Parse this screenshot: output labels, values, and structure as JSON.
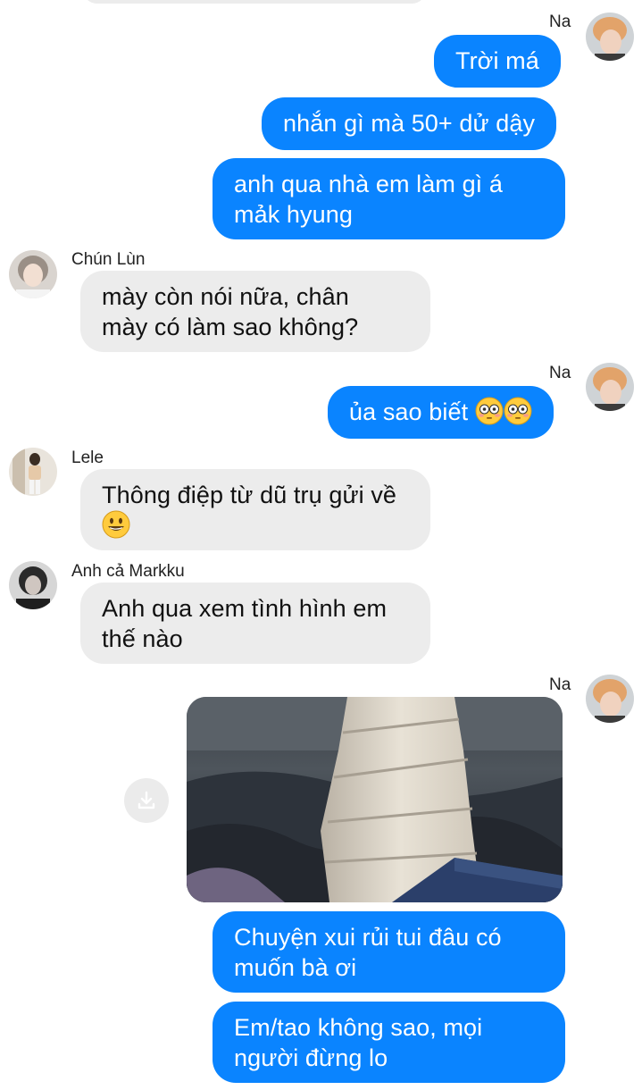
{
  "messages": [
    {
      "sender": "Na",
      "text": "Trời má"
    },
    {
      "text": "nhắn gì mà 50+ dử dậy"
    },
    {
      "text": "anh qua nhà em làm gì á\nmảk hyung"
    },
    {
      "sender": "Chún Lùn",
      "text": "mày còn nói nữa, chân\nmày có làm sao không?"
    },
    {
      "sender": "Na",
      "text": "ủa sao biết "
    },
    {
      "sender": "Lele",
      "text": "Thông điệp từ dũ trụ gửi về\n"
    },
    {
      "sender": "Anh cả Markku",
      "text": "Anh qua xem tình hình em\nthế nào"
    },
    {
      "sender": "Na"
    },
    {
      "text": "Chuyện xui rủi tui đâu có\nmuốn bà ơi"
    },
    {
      "text": "Em/tao không sao, mọi\nngười đừng lo"
    }
  ],
  "icons": {
    "flushed": "flushed-face-emoji",
    "grin": "grinning-face-emoji",
    "save": "download-icon"
  },
  "colors": {
    "outgoing": "#0a84ff",
    "incoming": "#ececec"
  }
}
